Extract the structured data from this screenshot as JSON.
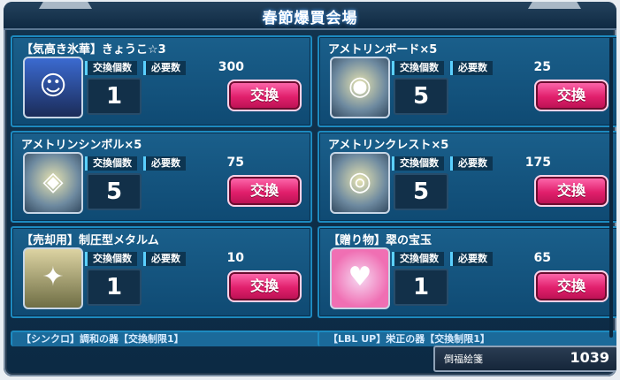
{
  "header": {
    "title": "春節爆買会場"
  },
  "labels": {
    "quantity": "交換個数",
    "required": "必要数",
    "exchange": "交換"
  },
  "items": [
    {
      "name": "【気高き氷華】きょうこ☆3",
      "required": "300",
      "quantity": "1",
      "icon": "character-portrait-icon"
    },
    {
      "name": "アメトリンボード×5",
      "required": "25",
      "quantity": "5",
      "icon": "board-disc-icon"
    },
    {
      "name": "アメトリンシンボル×5",
      "required": "75",
      "quantity": "5",
      "icon": "symbol-badge-icon"
    },
    {
      "name": "アメトリンクレスト×5",
      "required": "175",
      "quantity": "5",
      "icon": "crest-ring-icon"
    },
    {
      "name": "【売却用】制圧型メタルム",
      "required": "10",
      "quantity": "1",
      "icon": "metallum-icon"
    },
    {
      "name": "【贈り物】翠の宝玉",
      "required": "65",
      "quantity": "1",
      "icon": "jade-gem-icon"
    }
  ],
  "peek_items": [
    {
      "name": "【シンクロ】調和の器【交換制限1】"
    },
    {
      "name": "【LBL UP】栄正の器【交換制限1】"
    }
  ],
  "currency": {
    "label": "倒福絵箋",
    "value": "1039"
  }
}
